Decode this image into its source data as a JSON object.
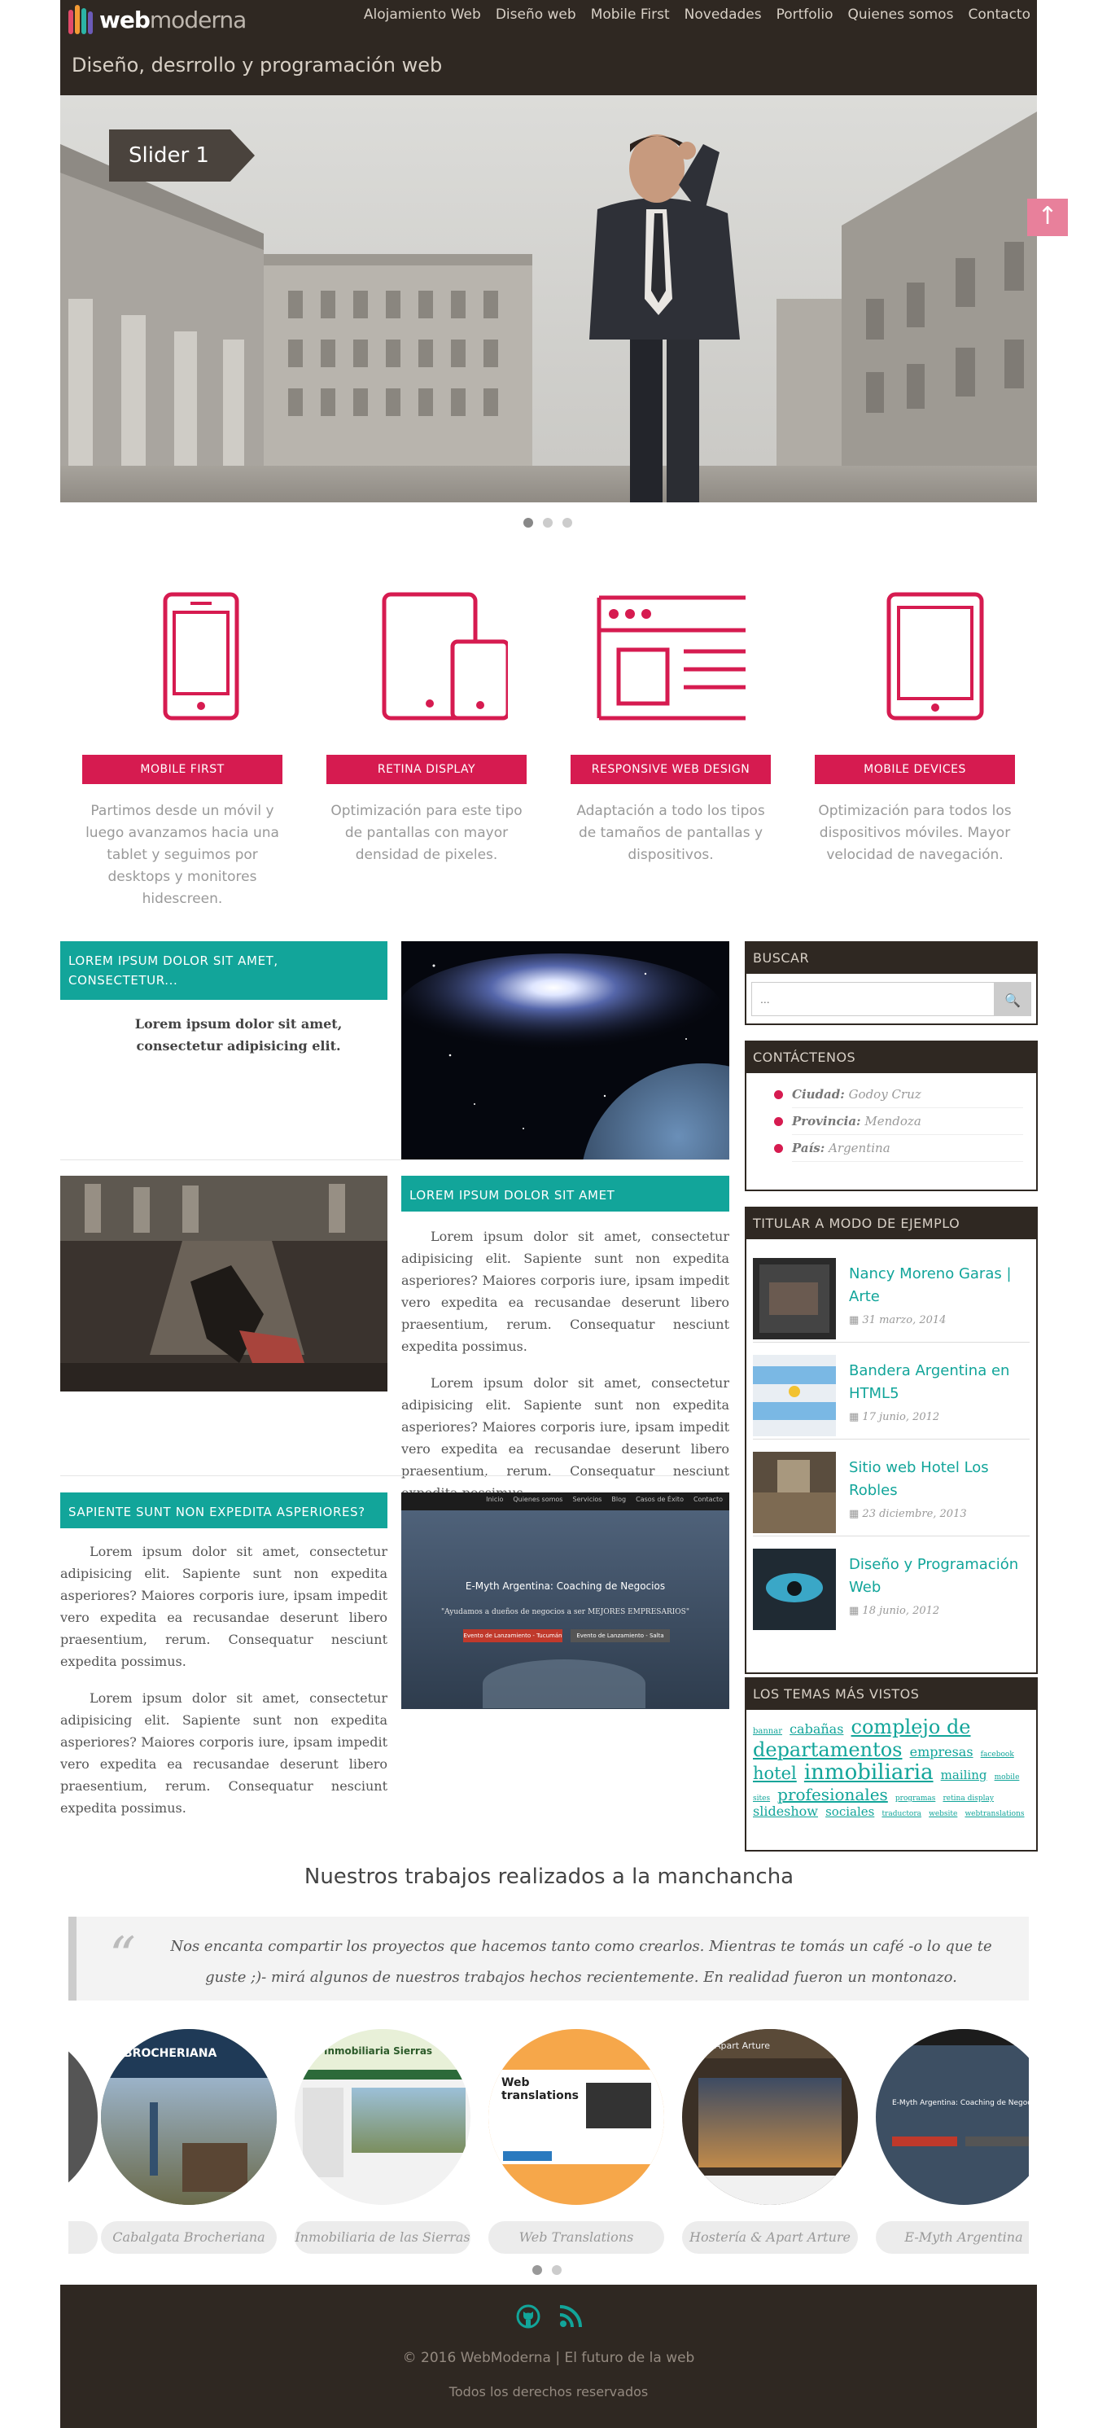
{
  "header": {
    "logo_bold": "web",
    "logo_thin": "moderna",
    "tagline": "Diseño, desrrollo y programación web",
    "nav": [
      "Alojamiento Web",
      "Diseño web",
      "Mobile First",
      "Novedades",
      "Portfolio",
      "Quienes somos",
      "Contacto"
    ]
  },
  "slider": {
    "caption": "Slider 1",
    "scroll_top_icon": "↑",
    "dots": 3,
    "active_dot": 1
  },
  "features": [
    {
      "icon": "smartphone-icon",
      "button": "MOBILE FIRST",
      "text": "Partimos desde un móvil y luego avanzamos hacia una tablet y seguimos por desktops y monitores hidescreen."
    },
    {
      "icon": "tablet-phone-icon",
      "button": "RETINA DISPLAY",
      "text": "Optimización para este tipo de pantallas con mayor densidad de pixeles."
    },
    {
      "icon": "responsive-layout-icon",
      "button": "RESPONSIVE WEB DESIGN",
      "text": "Adaptación a todo los tipos de tamaños de pantallas y dispositivos."
    },
    {
      "icon": "tablet-icon",
      "button": "MOBILE DEVICES",
      "text": "Optimización para todos los dispositivos móviles. Mayor velocidad de navegación."
    }
  ],
  "content": {
    "block1": {
      "heading": "LOREM IPSUM DOLOR SIT AMET, CONSECTETUR...",
      "text": "Lorem ipsum dolor sit amet, consectetur adipisicing elit."
    },
    "block2": {
      "heading": "LOREM IPSUM DOLOR SIT AMET",
      "p1": "Lorem ipsum dolor sit amet, consectetur adipisicing elit. Sapiente sunt non expedita asperiores? Maiores corporis iure, ipsam impedit vero expedita ea recusandae deserunt libero praesentium, rerum. Consequatur nesciunt expedita possimus.",
      "p2": "Lorem ipsum dolor sit amet, consectetur adipisicing elit. Sapiente sunt non expedita asperiores? Maiores corporis iure, ipsam impedit vero expedita ea recusandae deserunt libero praesentium, rerum. Consequatur nesciunt expedita possimus."
    },
    "block3": {
      "heading": "SAPIENTE SUNT NON EXPEDITA ASPERIORES?",
      "p1": "Lorem ipsum dolor sit amet, consectetur adipisicing elit. Sapiente sunt non expedita asperiores? Maiores corporis iure, ipsam impedit vero expedita ea recusandae deserunt libero praesentium, rerum. Consequatur nesciunt expedita possimus.",
      "p2": "Lorem ipsum dolor sit amet, consectetur adipisicing elit. Sapiente sunt non expedita asperiores? Maiores corporis iure, ipsam impedit vero expedita ea recusandae deserunt libero praesentium, rerum. Consequatur nesciunt expedita possimus."
    },
    "screenshot": {
      "nav": [
        "Inicio",
        "Quienes somos",
        "Servicios",
        "Blog",
        "Casos de Éxito",
        "Contacto"
      ],
      "title": "E-Myth Argentina: Coaching de Negocios",
      "subtitle": "\"Ayudamos a dueños de negocios a ser MEJORES EMPRESARIOS\"",
      "btn1": "Evento de Lanzamiento - Tucumán",
      "btn2": "Evento de Lanzamiento - Salta"
    }
  },
  "sidebar": {
    "search": {
      "title": "BUSCAR",
      "placeholder": "...",
      "button_icon": "🔍"
    },
    "contact": {
      "title": "CONTÁCTENOS",
      "items": [
        {
          "label": "Ciudad:",
          "value": "Godoy Cruz"
        },
        {
          "label": "Provincia:",
          "value": "Mendoza"
        },
        {
          "label": "País:",
          "value": "Argentina"
        }
      ]
    },
    "posts": {
      "title": "TITULAR A MODO DE EJEMPLO",
      "items": [
        {
          "title": "Nancy Moreno Garas | Arte",
          "date": "31 marzo, 2014"
        },
        {
          "title": "Bandera Argentina en HTML5",
          "date": "17 junio, 2012"
        },
        {
          "title": "Sitio web Hotel Los Robles",
          "date": "23 diciembre, 2013"
        },
        {
          "title": "Diseño y Programación Web",
          "date": "18 junio, 2012"
        }
      ]
    },
    "tags": {
      "title": "LOS TEMAS MÁS VISTOS",
      "items": [
        {
          "t": "bannar",
          "s": 10
        },
        {
          "t": "cabañas",
          "s": 16
        },
        {
          "t": "complejo de departamentos",
          "s": 24
        },
        {
          "t": "mentos",
          "s": 0
        },
        {
          "t": "empresas",
          "s": 16
        },
        {
          "t": "facebook",
          "s": 9
        },
        {
          "t": "hotel",
          "s": 21
        },
        {
          "t": "inmobiliaria",
          "s": 26
        },
        {
          "t": "mailing",
          "s": 15
        },
        {
          "t": "mobile sites",
          "s": 9
        },
        {
          "t": "profesionales",
          "s": 20
        },
        {
          "t": "programas",
          "s": 9
        },
        {
          "t": "retina display",
          "s": 9
        },
        {
          "t": "slideshow",
          "s": 16
        },
        {
          "t": "sociales",
          "s": 15
        },
        {
          "t": "traductora",
          "s": 9
        },
        {
          "t": "website",
          "s": 9
        },
        {
          "t": "webtranslations",
          "s": 9
        }
      ]
    }
  },
  "portfolio": {
    "title": "Nuestros trabajos realizados a la manchancha",
    "quote_mark": "“",
    "quote": "Nos encanta compartir los proyectos que hacemos tanto como crearlos. Mientras te tomás un café -o lo que te guste ;)- mirá algunos de nuestros trabajos hechos recientemente. En realidad fueron un montonazo.",
    "items": [
      {
        "caption": "Cabalgata Brocheriana",
        "img_text": "BROCHERIANA"
      },
      {
        "caption": "Inmobiliaria de las Sierras",
        "img_text": "Inmobiliaria Sierras"
      },
      {
        "caption": "Web Translations",
        "img_text": "Web translations"
      },
      {
        "caption": "Hostería & Apart Arture",
        "img_text": "Apart Arture"
      },
      {
        "caption": "E-Myth Argentina",
        "img_text": "E-Myth Argentina: Coaching de Negocios"
      }
    ],
    "dots": 2
  },
  "footer": {
    "icons": [
      "github-icon",
      "rss-icon"
    ],
    "copyright": "© 2016 WebModerna | El futuro de la web",
    "rights": "Todos los derechos reservados"
  },
  "colors": {
    "dark": "#2f2822",
    "accent": "#d61b50",
    "teal": "#12a59a"
  }
}
